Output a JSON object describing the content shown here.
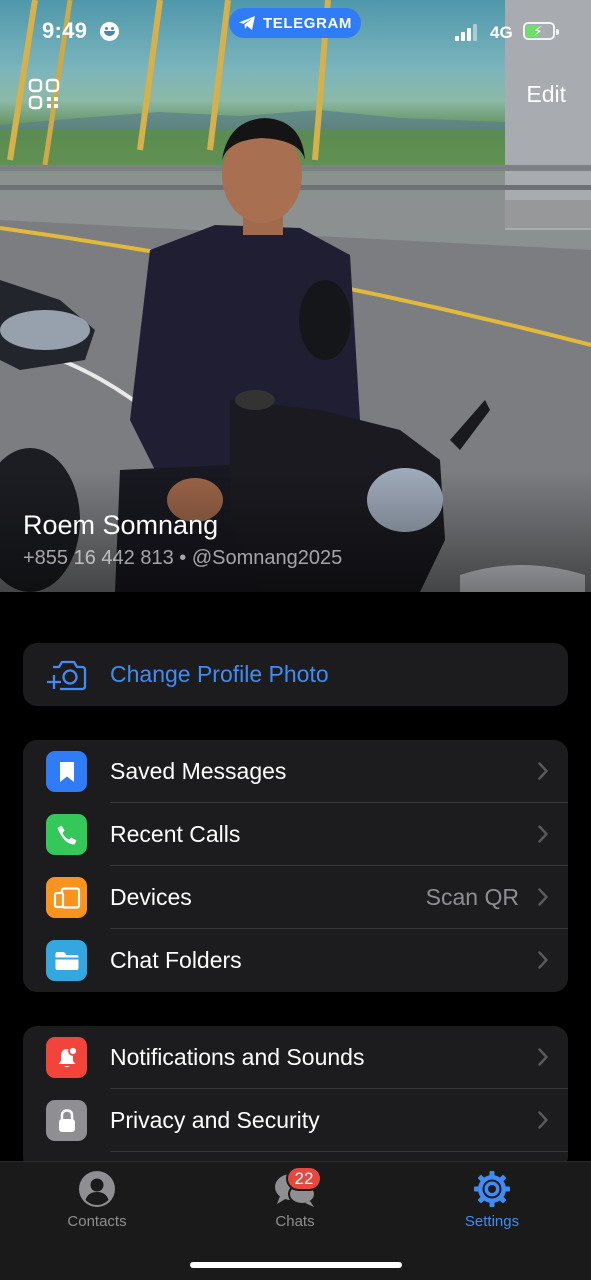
{
  "status_bar": {
    "time": "9:49",
    "app_pill": "TELEGRAM",
    "network": "4G",
    "battery_level": 0.45
  },
  "header": {
    "edit_label": "Edit",
    "qr_icon": "qr-code-icon"
  },
  "profile": {
    "name": "Roem Somnang",
    "subtitle": "+855 16 442 813 • @Somnang2025"
  },
  "photo_group": {
    "change_photo_label": "Change Profile Photo",
    "icon": "camera-add-icon"
  },
  "group1": {
    "items": [
      {
        "label": "Saved Messages",
        "icon": "bookmark-icon",
        "color": "#2f7cf6"
      },
      {
        "label": "Recent Calls",
        "icon": "phone-icon",
        "color": "#34c759"
      },
      {
        "label": "Devices",
        "value": "Scan QR",
        "icon": "devices-icon",
        "color": "#f7931e"
      },
      {
        "label": "Chat Folders",
        "icon": "folder-icon",
        "color": "#35a7e0"
      }
    ]
  },
  "group2": {
    "items": [
      {
        "label": "Notifications and Sounds",
        "icon": "bell-icon",
        "color": "#f2443a"
      },
      {
        "label": "Privacy and Security",
        "icon": "lock-icon",
        "color": "#8e8e93"
      }
    ]
  },
  "tabbar": {
    "contacts": "Contacts",
    "chats": "Chats",
    "chats_badge": "22",
    "settings": "Settings",
    "active": "Settings",
    "accent": "#3e8cf4"
  }
}
